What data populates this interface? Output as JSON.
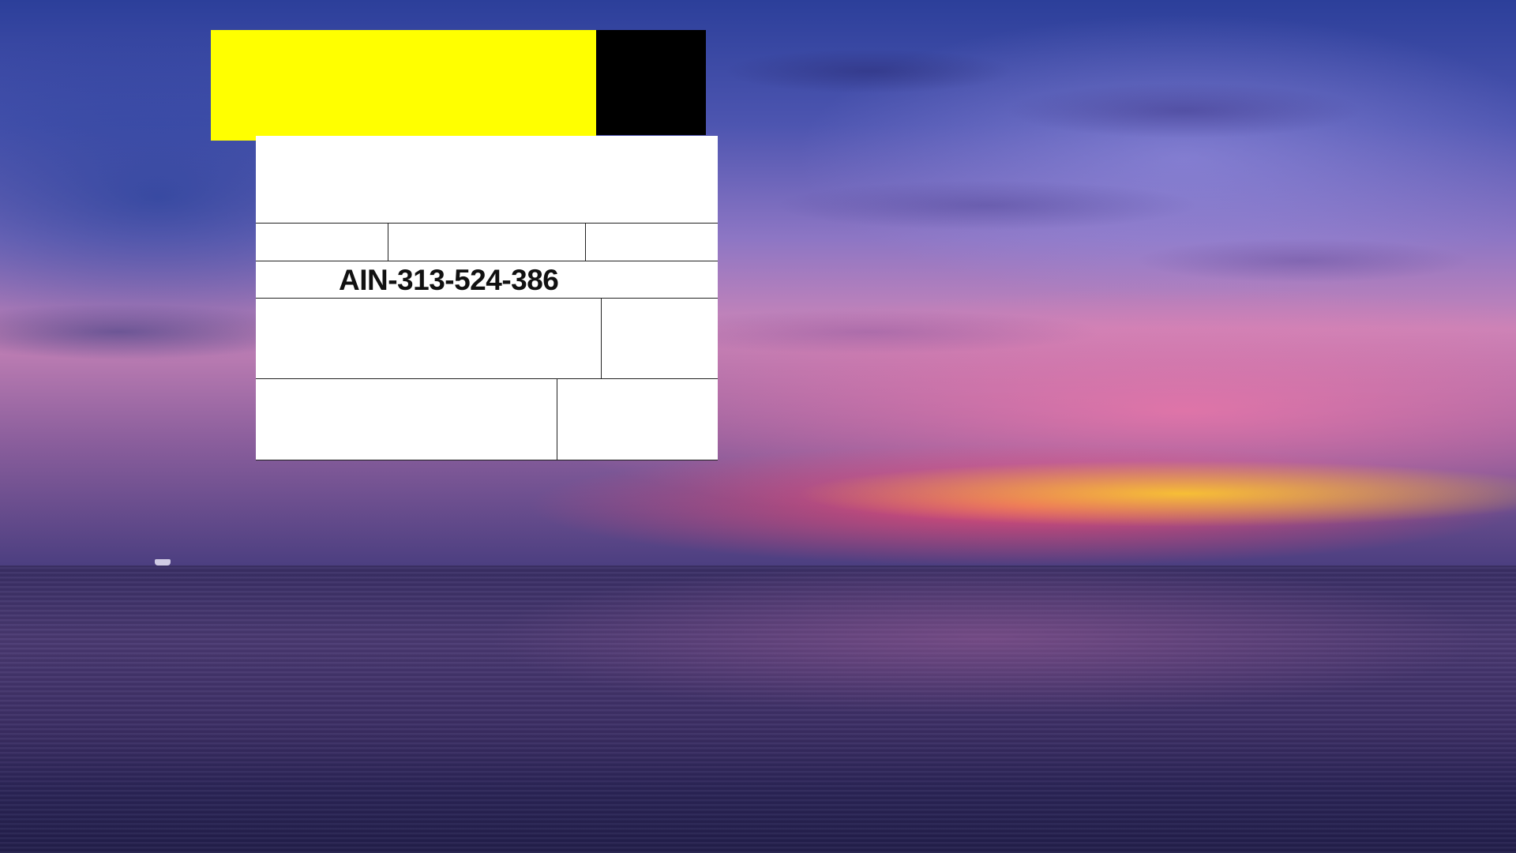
{
  "form": {
    "id_number": "AIN-313-524-386"
  },
  "colors": {
    "sticker_yellow": "#ffff00",
    "sticker_black": "#000000",
    "card_background": "#ffffff"
  },
  "wallpaper": {
    "scene": "sunset-over-sea"
  }
}
